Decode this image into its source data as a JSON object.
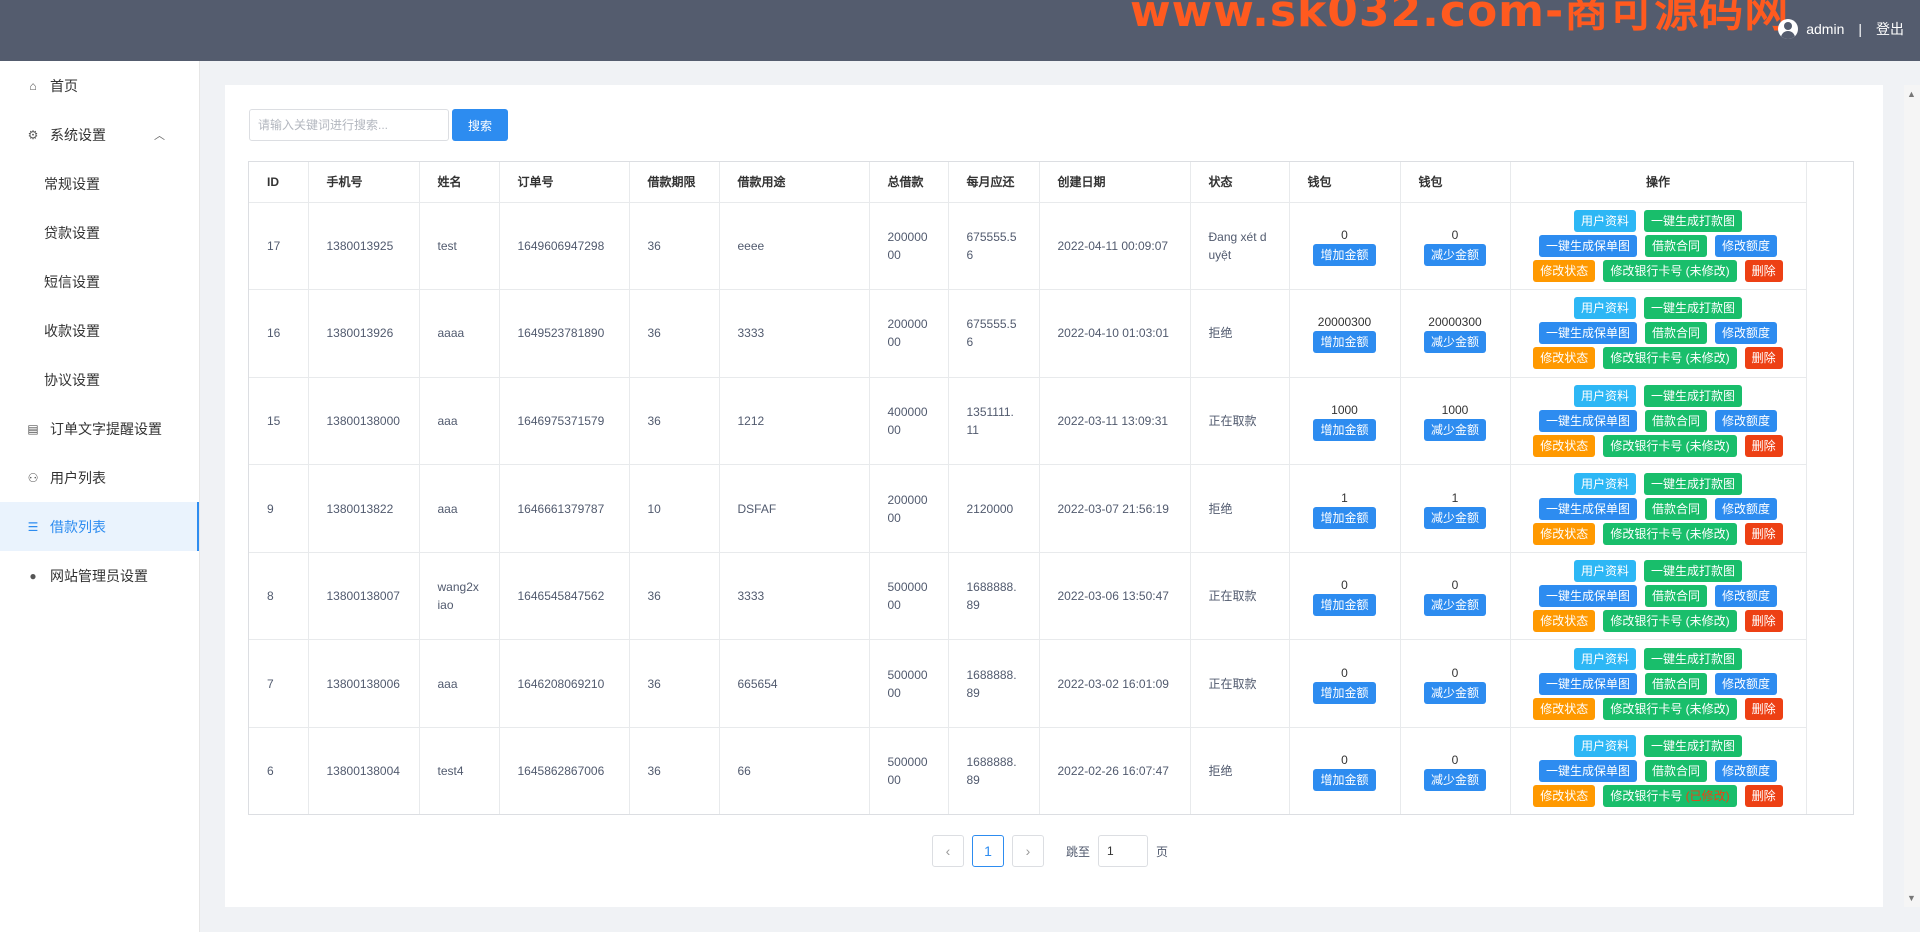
{
  "header": {
    "watermark": "www.sk032.com-商可源码网",
    "username": "admin",
    "separator": "|",
    "logout": "登出"
  },
  "sidebar": {
    "items": [
      {
        "label": "首页",
        "icon": "home-icon"
      },
      {
        "label": "系统设置",
        "icon": "gear-icon"
      },
      {
        "label": "常规设置"
      },
      {
        "label": "贷款设置"
      },
      {
        "label": "短信设置"
      },
      {
        "label": "收款设置"
      },
      {
        "label": "协议设置"
      },
      {
        "label": "订单文字提醒设置",
        "icon": "document-icon"
      },
      {
        "label": "用户列表",
        "icon": "users-icon"
      },
      {
        "label": "借款列表",
        "icon": "list-icon"
      },
      {
        "label": "网站管理员设置",
        "icon": "person-icon"
      }
    ]
  },
  "search": {
    "placeholder": "请输入关键词进行搜索...",
    "button": "搜索"
  },
  "table": {
    "headers": [
      "ID",
      "手机号",
      "姓名",
      "订单号",
      "借款期限",
      "借款用途",
      "总借款",
      "每月应还",
      "创建日期",
      "状态",
      "钱包",
      "钱包",
      "操作"
    ],
    "rows": [
      {
        "id": "17",
        "phone": "1380013925",
        "name": "test",
        "order": "1649606947298",
        "term": "36",
        "purpose": "eeee",
        "total": "20000000",
        "monthly": "675555.56",
        "date": "2022-04-11 00:09:07",
        "status": "Đang xét duyệt",
        "wallet1": "0",
        "wallet2": "0",
        "bank_label": "修改银行卡号",
        "bank_status": "(未修改)"
      },
      {
        "id": "16",
        "phone": "1380013926",
        "name": "aaaa",
        "order": "1649523781890",
        "term": "36",
        "purpose": "3333",
        "total": "20000000",
        "monthly": "675555.56",
        "date": "2022-04-10 01:03:01",
        "status": "拒绝",
        "wallet1": "20000300",
        "wallet2": "20000300",
        "bank_label": "修改银行卡号",
        "bank_status": "(未修改)"
      },
      {
        "id": "15",
        "phone": "13800138000",
        "name": "aaa",
        "order": "1646975371579",
        "term": "36",
        "purpose": "1212",
        "total": "40000000",
        "monthly": "1351111.11",
        "date": "2022-03-11 13:09:31",
        "status": "正在取款",
        "wallet1": "1000",
        "wallet2": "1000",
        "bank_label": "修改银行卡号",
        "bank_status": "(未修改)"
      },
      {
        "id": "9",
        "phone": "1380013822",
        "name": "aaa",
        "order": "1646661379787",
        "term": "10",
        "purpose": "DSFAF",
        "total": "20000000",
        "monthly": "2120000",
        "date": "2022-03-07 21:56:19",
        "status": "拒绝",
        "wallet1": "1",
        "wallet2": "1",
        "bank_label": "修改银行卡号",
        "bank_status": "(未修改)"
      },
      {
        "id": "8",
        "phone": "13800138007",
        "name": "wang2xiao",
        "order": "1646545847562",
        "term": "36",
        "purpose": "3333",
        "total": "50000000",
        "monthly": "1688888.89",
        "date": "2022-03-06 13:50:47",
        "status": "正在取款",
        "wallet1": "0",
        "wallet2": "0",
        "bank_label": "修改银行卡号",
        "bank_status": "(未修改)"
      },
      {
        "id": "7",
        "phone": "13800138006",
        "name": "aaa",
        "order": "1646208069210",
        "term": "36",
        "purpose": "665654",
        "total": "50000000",
        "monthly": "1688888.89",
        "date": "2022-03-02 16:01:09",
        "status": "正在取款",
        "wallet1": "0",
        "wallet2": "0",
        "bank_label": "修改银行卡号",
        "bank_status": "(未修改)"
      },
      {
        "id": "6",
        "phone": "13800138004",
        "name": "test4",
        "order": "1645862867006",
        "term": "36",
        "purpose": "66",
        "total": "50000000",
        "monthly": "1688888.89",
        "date": "2022-02-26 16:07:47",
        "status": "拒绝",
        "wallet1": "0",
        "wallet2": "0",
        "bank_label": "修改银行卡号",
        "bank_status": "(已修改)"
      }
    ],
    "row_actions": {
      "user_info": "用户资料",
      "gen_print": "一键生成打款图",
      "gen_policy": "一键生成保单图",
      "contract": "借款合同",
      "edit_quota": "修改额度",
      "edit_status": "修改状态",
      "delete": "删除",
      "add_amount": "增加金额",
      "reduce_amount": "减少金额"
    }
  },
  "pagination": {
    "prev": "‹",
    "current": "1",
    "next": "›",
    "jump_label": "跳至",
    "jump_value": "1",
    "page_suffix": "页"
  },
  "colors": {
    "header_bg": "#545c6e",
    "primary": "#2d8cf0",
    "info": "#2db7f5",
    "success": "#19be6b",
    "warning": "#ff9900",
    "danger": "#ed4014",
    "watermark": "#ff5a1f"
  }
}
